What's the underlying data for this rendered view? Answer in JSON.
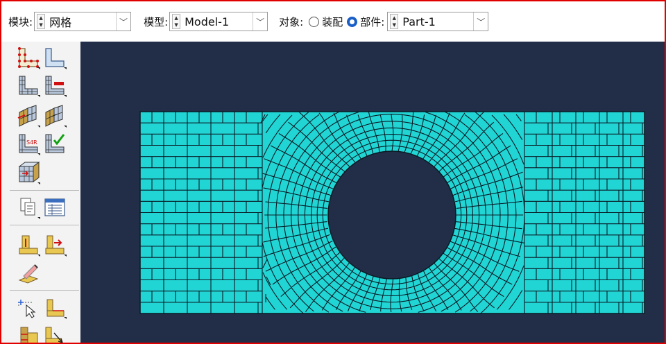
{
  "toolbar": {
    "module_label": "模块:",
    "module_value": "网格",
    "model_label": "模型:",
    "model_value": "Model-1",
    "object_label": "对象:",
    "assembly_label": "装配",
    "part_label": "部件:",
    "part_value": "Part-1",
    "selected_object": "part"
  },
  "colors": {
    "mesh_fill": "#22d5d5",
    "mesh_lines": "#0a1a24",
    "viewport_background": "#222e48",
    "radio_selected": "#1a5fc7",
    "frame_border": "#e00000"
  },
  "sidebar_tools": [
    "seed-part-icon",
    "seed-edge-icon",
    "mesh-controls-icon",
    "element-type-icon",
    "mesh-part-icon",
    "mesh-region-icon",
    "s4r-element-icon",
    "verify-mesh-icon",
    "partition-cell-icon",
    "query-info-icon",
    "display-options-icon",
    "create-datum-icon",
    "associate-geometry-icon",
    "edit-mesh-icon",
    "virtual-topology-icon",
    "combine-faces-icon",
    "extrude-mesh-icon",
    "cursor-tool-icon"
  ]
}
